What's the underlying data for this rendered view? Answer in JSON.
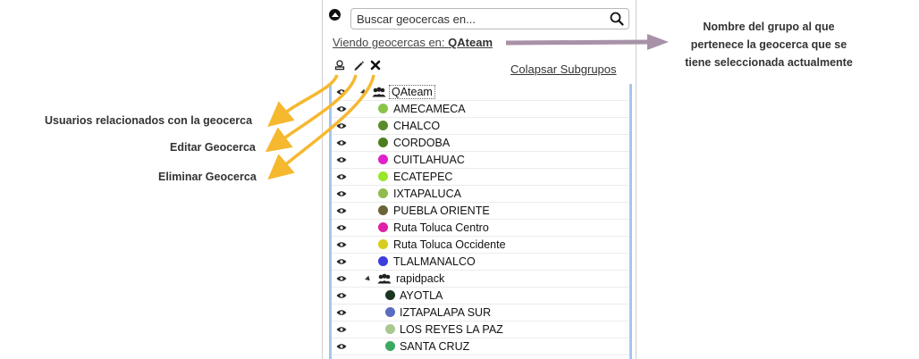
{
  "search": {
    "placeholder": "Buscar geocercas en..."
  },
  "viewing": {
    "prefix": "Viendo geocercas en:",
    "group": "QAteam"
  },
  "toolbar": {
    "collapse_subgroups": "Colapsar Subgrupos"
  },
  "tree": {
    "groups": [
      {
        "name": "QAteam",
        "selected": true,
        "items": [
          {
            "name": "AMECAMECA",
            "color": "#8bc34a"
          },
          {
            "name": "CHALCO",
            "color": "#5a8a2a"
          },
          {
            "name": "CORDOBA",
            "color": "#4e7e1c"
          },
          {
            "name": "CUITLAHUAC",
            "color": "#e020c8"
          },
          {
            "name": "ECATEPEC",
            "color": "#99e62a"
          },
          {
            "name": "IXTAPALUCA",
            "color": "#8fbc4a"
          },
          {
            "name": "PUEBLA ORIENTE",
            "color": "#6b6438"
          },
          {
            "name": "Ruta Toluca Centro",
            "color": "#e020a8"
          },
          {
            "name": "Ruta Toluca Occidente",
            "color": "#d8cc1e"
          },
          {
            "name": "TLALMANALCO",
            "color": "#3c3ce0"
          }
        ]
      },
      {
        "name": "rapidpack",
        "selected": false,
        "items": [
          {
            "name": "AYOTLA",
            "color": "#1a3520"
          },
          {
            "name": "IZTAPALAPA SUR",
            "color": "#5a6cc0"
          },
          {
            "name": "LOS REYES LA PAZ",
            "color": "#a8c890"
          },
          {
            "name": "SANTA CRUZ",
            "color": "#3aaa60"
          }
        ]
      }
    ]
  },
  "annotations": {
    "group_note": [
      "Nombre del grupo al que",
      "pertenece la geocerca que se",
      "tiene seleccionada actualmente"
    ],
    "users_note": "Usuarios relacionados con la geocerca",
    "edit_note": "Editar Geocerca",
    "delete_note": "Eliminar Geocerca"
  },
  "colors": {
    "arrow_yellow": "#f5b82e",
    "arrow_purple": "#a892a8",
    "tree_border": "#a6c6ec"
  },
  "icons": [
    "collapse-icon",
    "search-icon",
    "user-stamp-icon",
    "pencil-icon",
    "delete-x-icon",
    "eye-icon",
    "group-icon"
  ]
}
